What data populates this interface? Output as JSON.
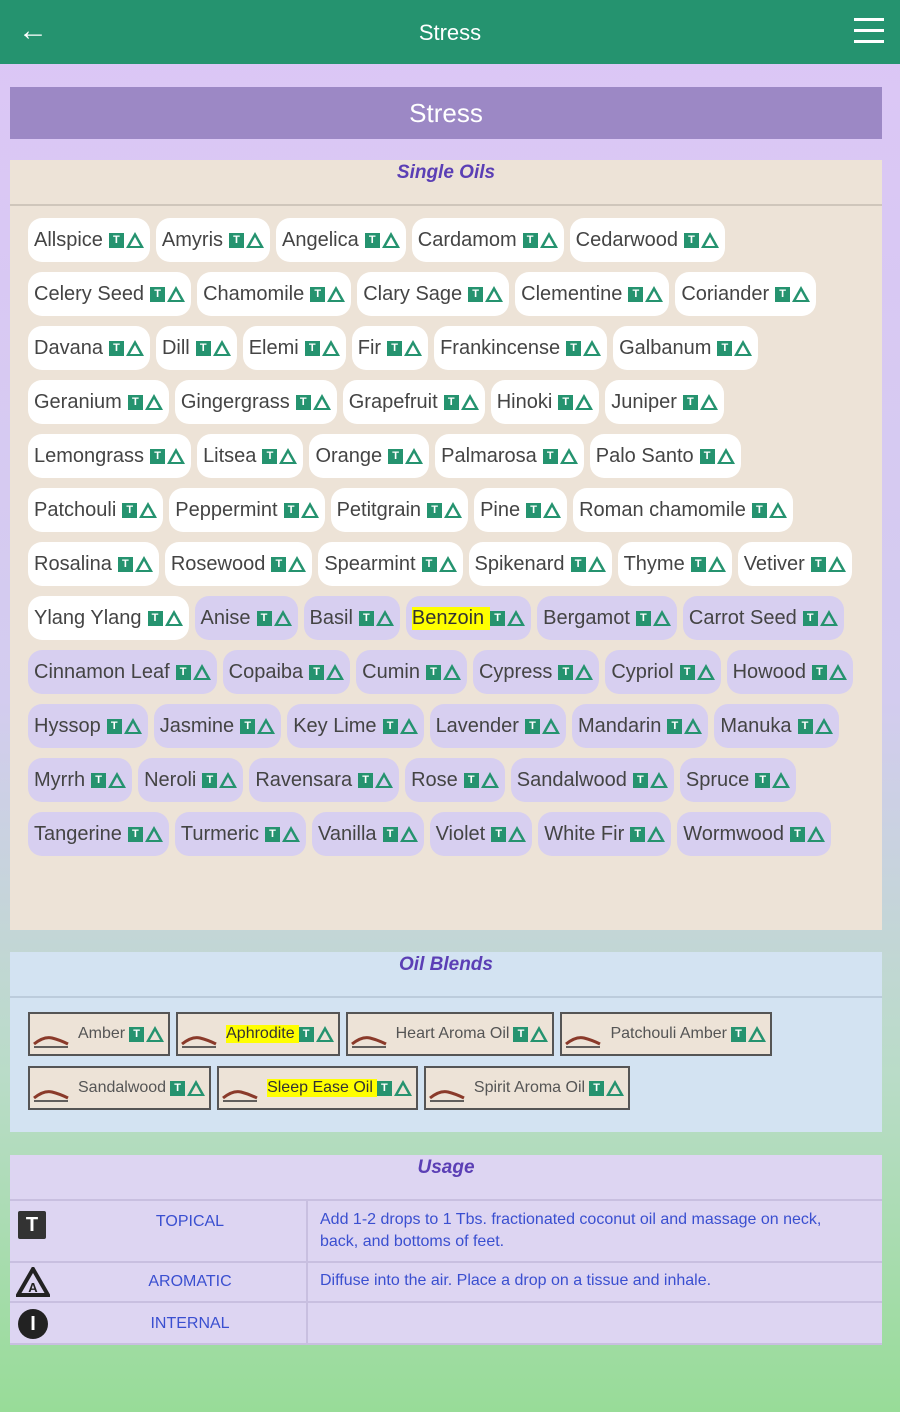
{
  "appbar": {
    "title": "Stress",
    "back_icon": "arrow-left-icon",
    "menu_icon": "hamburger-menu-icon"
  },
  "header": {
    "title": "Stress"
  },
  "singles": {
    "heading": "Single Oils",
    "items": [
      {
        "name": "Allspice",
        "style": "white"
      },
      {
        "name": "Amyris",
        "style": "white"
      },
      {
        "name": "Angelica",
        "style": "white"
      },
      {
        "name": "Cardamom",
        "style": "white"
      },
      {
        "name": "Cedarwood",
        "style": "white"
      },
      {
        "name": "Celery Seed",
        "style": "white"
      },
      {
        "name": "Chamomile",
        "style": "white"
      },
      {
        "name": "Clary Sage",
        "style": "white"
      },
      {
        "name": "Clementine",
        "style": "white"
      },
      {
        "name": "Coriander",
        "style": "white"
      },
      {
        "name": "Davana",
        "style": "white"
      },
      {
        "name": "Dill",
        "style": "white"
      },
      {
        "name": "Elemi",
        "style": "white"
      },
      {
        "name": "Fir",
        "style": "white"
      },
      {
        "name": "Frankincense",
        "style": "white"
      },
      {
        "name": "Galbanum",
        "style": "white"
      },
      {
        "name": "Geranium",
        "style": "white"
      },
      {
        "name": "Gingergrass",
        "style": "white"
      },
      {
        "name": "Grapefruit",
        "style": "white"
      },
      {
        "name": "Hinoki",
        "style": "white"
      },
      {
        "name": "Juniper",
        "style": "white"
      },
      {
        "name": "Lemongrass",
        "style": "white"
      },
      {
        "name": "Litsea",
        "style": "white"
      },
      {
        "name": "Orange",
        "style": "white"
      },
      {
        "name": "Palmarosa",
        "style": "white"
      },
      {
        "name": "Palo Santo",
        "style": "white"
      },
      {
        "name": "Patchouli",
        "style": "white"
      },
      {
        "name": "Peppermint",
        "style": "white"
      },
      {
        "name": "Petitgrain",
        "style": "white"
      },
      {
        "name": "Pine",
        "style": "white"
      },
      {
        "name": "Roman chamomile",
        "style": "white"
      },
      {
        "name": "Rosalina",
        "style": "white"
      },
      {
        "name": "Rosewood",
        "style": "white"
      },
      {
        "name": "Spearmint",
        "style": "white"
      },
      {
        "name": "Spikenard",
        "style": "white"
      },
      {
        "name": "Thyme",
        "style": "white"
      },
      {
        "name": "Vetiver",
        "style": "white"
      },
      {
        "name": "Ylang Ylang",
        "style": "white"
      },
      {
        "name": "Anise",
        "style": "lavender"
      },
      {
        "name": "Basil",
        "style": "lavender"
      },
      {
        "name": "Benzoin",
        "style": "lavender",
        "highlight": true
      },
      {
        "name": "Bergamot",
        "style": "lavender"
      },
      {
        "name": "Carrot Seed",
        "style": "lavender"
      },
      {
        "name": "Cinnamon Leaf",
        "style": "lavender"
      },
      {
        "name": "Copaiba",
        "style": "lavender"
      },
      {
        "name": "Cumin",
        "style": "lavender"
      },
      {
        "name": "Cypress",
        "style": "lavender"
      },
      {
        "name": "Cypriol",
        "style": "lavender"
      },
      {
        "name": "Howood",
        "style": "lavender"
      },
      {
        "name": "Hyssop",
        "style": "lavender"
      },
      {
        "name": "Jasmine",
        "style": "lavender"
      },
      {
        "name": "Key Lime",
        "style": "lavender"
      },
      {
        "name": "Lavender",
        "style": "lavender"
      },
      {
        "name": "Mandarin",
        "style": "lavender"
      },
      {
        "name": "Manuka",
        "style": "lavender"
      },
      {
        "name": "Myrrh",
        "style": "lavender"
      },
      {
        "name": "Neroli",
        "style": "lavender"
      },
      {
        "name": "Ravensara",
        "style": "lavender"
      },
      {
        "name": "Rose",
        "style": "lavender"
      },
      {
        "name": "Sandalwood",
        "style": "lavender"
      },
      {
        "name": "Spruce",
        "style": "lavender"
      },
      {
        "name": "Tangerine",
        "style": "lavender"
      },
      {
        "name": "Turmeric",
        "style": "lavender"
      },
      {
        "name": "Vanilla",
        "style": "lavender"
      },
      {
        "name": "Violet",
        "style": "lavender"
      },
      {
        "name": "White Fir",
        "style": "lavender"
      },
      {
        "name": "Wormwood",
        "style": "lavender"
      }
    ]
  },
  "blends": {
    "heading": "Oil Blends",
    "items": [
      {
        "name": "Amber"
      },
      {
        "name": "Aphrodite",
        "highlight": true
      },
      {
        "name": "Heart Aroma Oil"
      },
      {
        "name": "Patchouli Amber"
      },
      {
        "name": "Sandalwood"
      },
      {
        "name": "Sleep Ease Oil",
        "highlight": true
      },
      {
        "name": "Spirit Aroma Oil"
      }
    ]
  },
  "usage": {
    "heading": "Usage",
    "rows": [
      {
        "icon": "T",
        "icon_name": "topical-icon",
        "label": "TOPICAL",
        "desc": "Add 1-2 drops to 1 Tbs. fractionated coconut oil and massage on neck, back, and bottoms of feet."
      },
      {
        "icon": "A",
        "icon_name": "aromatic-icon",
        "label": "AROMATIC",
        "desc": "Diffuse into the air. Place a drop on a tissue and inhale."
      },
      {
        "icon": "I",
        "icon_name": "internal-icon",
        "label": "INTERNAL",
        "desc": ""
      }
    ]
  },
  "colors": {
    "appbar": "#25936f",
    "accent_text": "#5b3fb5",
    "link": "#3a4fd0",
    "highlight": "#ffff00"
  }
}
